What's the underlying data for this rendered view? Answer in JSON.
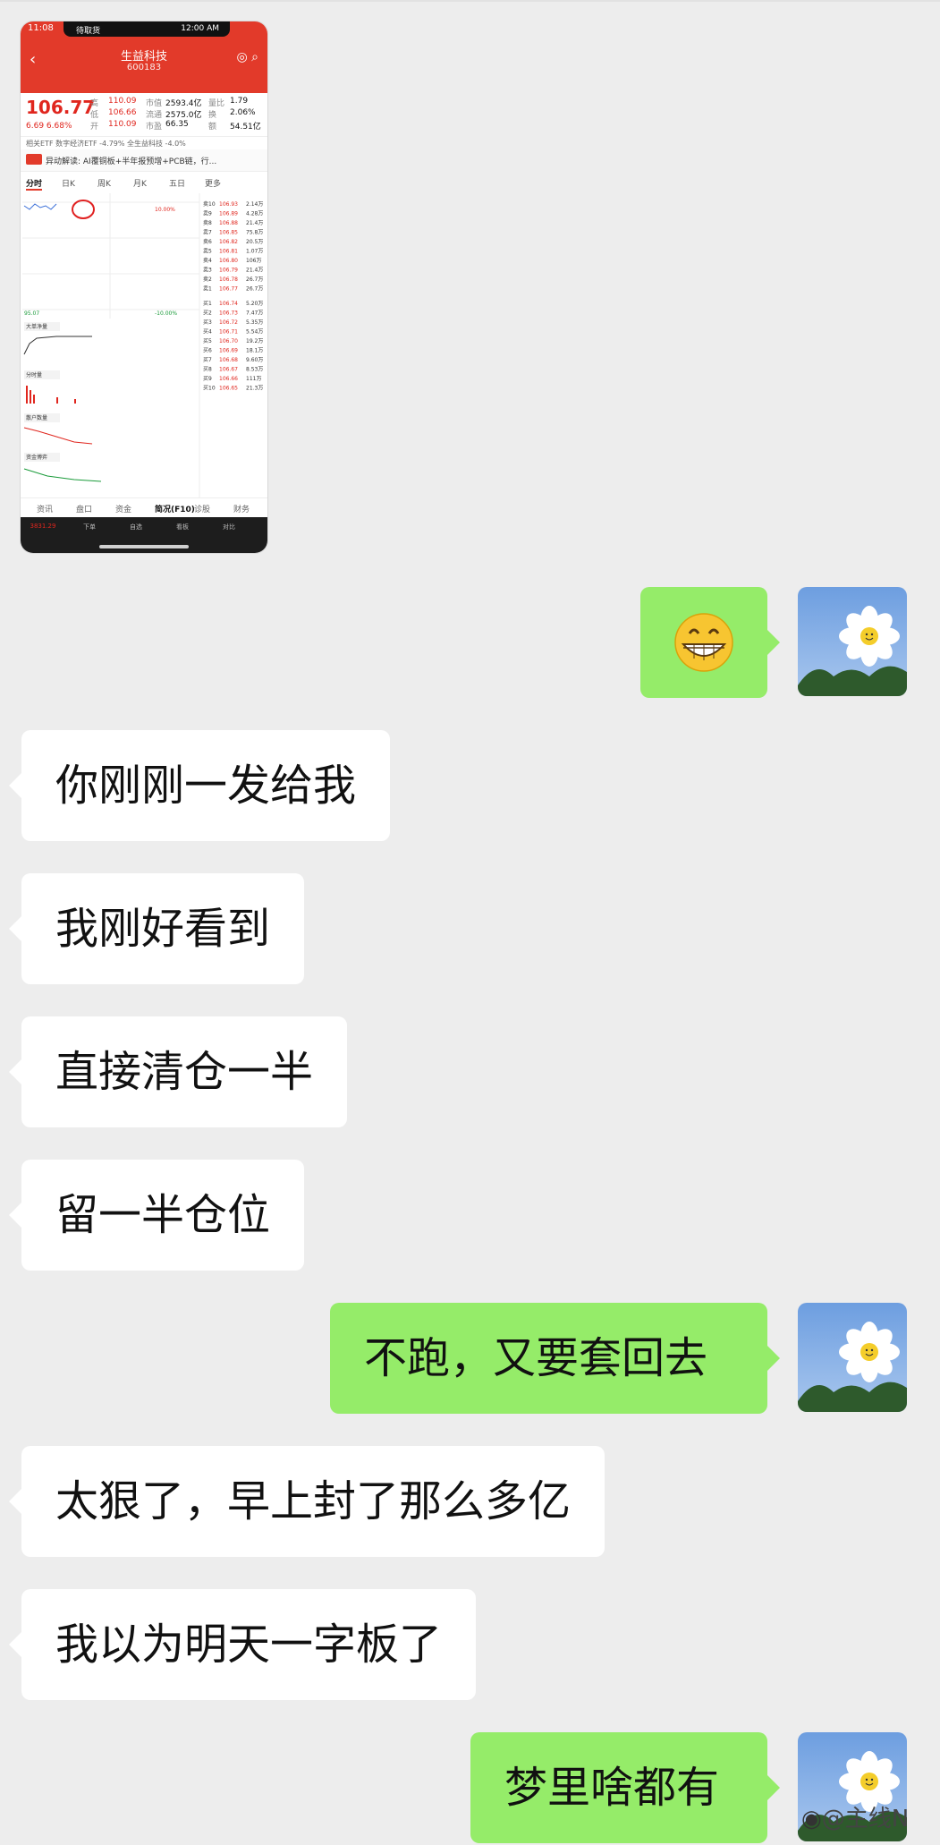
{
  "phone_screenshot": {
    "status": {
      "time": "11:08",
      "app": "待取货",
      "center_time": "12:00 AM"
    },
    "header": {
      "name": "生益科技",
      "code": "600183"
    },
    "quote": {
      "price": "106.77",
      "change": "6.69  6.68%",
      "rows": [
        [
          "高",
          "110.09",
          "市值",
          "2593.4亿",
          "量比",
          "1.79"
        ],
        [
          "低",
          "106.66",
          "流通",
          "2575.0亿",
          "换",
          "2.06%"
        ],
        [
          "开",
          "110.09",
          "市盈",
          "66.35",
          "额",
          "54.51亿"
        ]
      ]
    },
    "etf_line": "相关ETF  数字经济ETF -4.79%  全生益科技 -4.0%",
    "news": "异动解读: AI覆铜板+半年报预增+PCB链，行...",
    "tabs": [
      "分时",
      "日K",
      "周K",
      "月K",
      "五日",
      "更多"
    ],
    "bottom_tabs": [
      "资讯",
      "盘口",
      "资金",
      "简况(F10)",
      "诊股",
      "财务"
    ],
    "nav": [
      "3831.29",
      "下单",
      "自选",
      "看板",
      "对比"
    ],
    "order_book": [
      [
        "卖10",
        "106.93",
        "2.14万"
      ],
      [
        "卖9",
        "106.89",
        "4.28万"
      ],
      [
        "卖8",
        "106.88",
        "21.4万"
      ],
      [
        "卖7",
        "106.85",
        "75.8万"
      ],
      [
        "卖6",
        "106.82",
        "20.5万"
      ],
      [
        "卖5",
        "106.81",
        "1.07万"
      ],
      [
        "卖4",
        "106.80",
        "106万"
      ],
      [
        "卖3",
        "106.79",
        "21.4万"
      ],
      [
        "卖2",
        "106.78",
        "26.7万"
      ],
      [
        "卖1",
        "106.77",
        "26.7万"
      ],
      [
        "买1",
        "106.74",
        "5.20万"
      ],
      [
        "买2",
        "106.73",
        "7.47万"
      ],
      [
        "买3",
        "106.72",
        "5.35万"
      ],
      [
        "买4",
        "106.71",
        "5.54万"
      ],
      [
        "买5",
        "106.70",
        "19.2万"
      ],
      [
        "买6",
        "106.69",
        "18.1万"
      ],
      [
        "买7",
        "106.68",
        "9.60万"
      ],
      [
        "买8",
        "106.67",
        "8.53万"
      ],
      [
        "买9",
        "106.66",
        "111万"
      ],
      [
        "买10",
        "106.65",
        "21.3万"
      ]
    ]
  },
  "messages": [
    {
      "side": "right",
      "type": "emoji",
      "content": "😁"
    },
    {
      "side": "left",
      "type": "text",
      "content": "你刚刚一发给我"
    },
    {
      "side": "left",
      "type": "text",
      "content": "我刚好看到"
    },
    {
      "side": "left",
      "type": "text",
      "content": "直接清仓一半"
    },
    {
      "side": "left",
      "type": "text",
      "content": "留一半仓位"
    },
    {
      "side": "right",
      "type": "text",
      "content": "不跑，又要套回去"
    },
    {
      "side": "left",
      "type": "text",
      "content": "太狠了，早上封了那么多亿"
    },
    {
      "side": "left",
      "type": "text",
      "content": "我以为明天一字板了"
    },
    {
      "side": "right",
      "type": "text",
      "content": "梦里啥都有"
    }
  ],
  "avatar": {
    "icon": "daisy-flower-avatar-icon"
  },
  "watermark": "@主线N",
  "colors": {
    "background": "#ededed",
    "bubble_self": "#95ec69",
    "bubble_other": "#ffffff",
    "stock_red": "#e23a2a"
  }
}
